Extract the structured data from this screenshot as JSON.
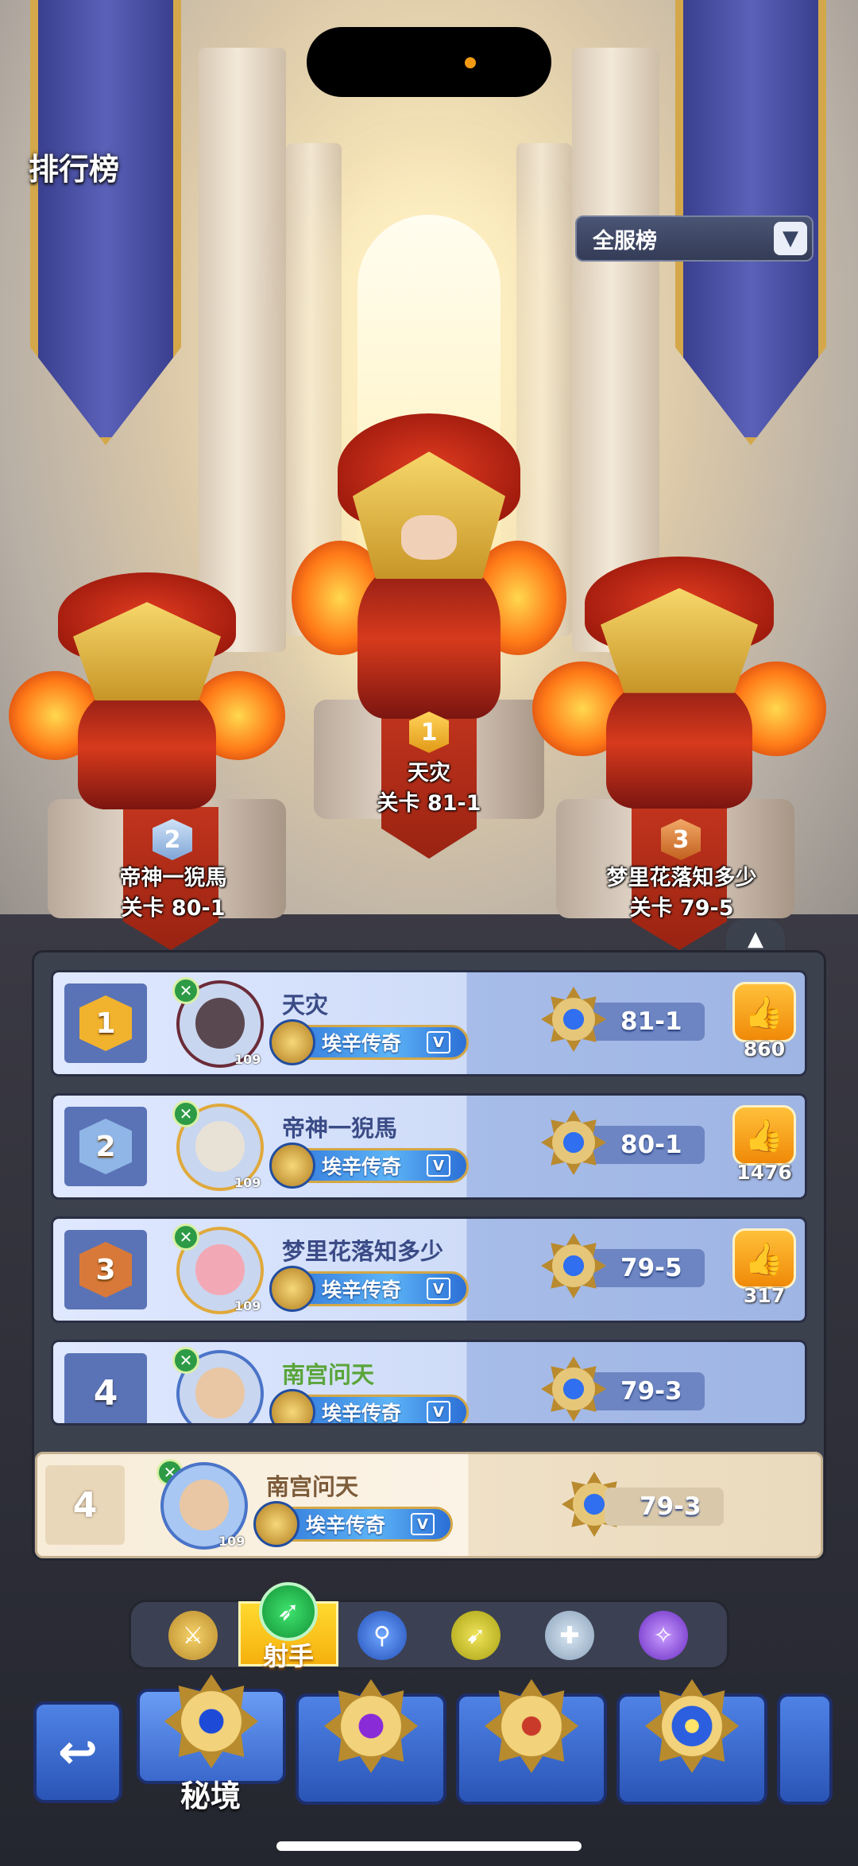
{
  "header": {
    "title": "排行榜"
  },
  "scope_dropdown": {
    "selected": "全服榜",
    "arrow_icon": "chevron-down-icon"
  },
  "podium": [
    {
      "rank": "1",
      "name": "天灾",
      "stage": "关卡 81-1"
    },
    {
      "rank": "2",
      "name": "帝神一猊馬",
      "stage": "关卡 80-1"
    },
    {
      "rank": "3",
      "name": "梦里花落知多少",
      "stage": "关卡 79-5"
    }
  ],
  "rankings": [
    {
      "rank": "1",
      "name": "天灾",
      "level": "109",
      "title": "埃辛传奇",
      "vip": "V",
      "stage": "81-1",
      "likes": "860",
      "medal_color": "#f1b32e"
    },
    {
      "rank": "2",
      "name": "帝神一猊馬",
      "level": "109",
      "title": "埃辛传奇",
      "vip": "V",
      "stage": "80-1",
      "likes": "1476",
      "medal_color": "#8fb6e6"
    },
    {
      "rank": "3",
      "name": "梦里花落知多少",
      "level": "109",
      "title": "埃辛传奇",
      "vip": "V",
      "stage": "79-5",
      "likes": "317",
      "medal_color": "#d8793a"
    },
    {
      "rank": "4",
      "name": "南宫问天",
      "level": "109",
      "title": "埃辛传奇",
      "vip": "V",
      "stage": "79-3",
      "likes": "",
      "medal_color": ""
    }
  ],
  "my_rank": {
    "rank": "4",
    "name": "南宫问天",
    "level": "109",
    "title": "埃辛传奇",
    "vip": "V",
    "stage": "79-3"
  },
  "class_tabs": {
    "icons": [
      "warrior-icon",
      "archer-icon",
      "mage-icon",
      "assassin-icon",
      "priest-icon",
      "summoner-icon"
    ],
    "active_label": "射手"
  },
  "bottom_nav": {
    "back_icon": "return-arrow-icon",
    "active_label": "秘境"
  },
  "colors": {
    "panel": "#3c414e",
    "row_blue": "#cfdcf8",
    "gold": "#f1b32e",
    "active_tab": "#ffd92f"
  }
}
